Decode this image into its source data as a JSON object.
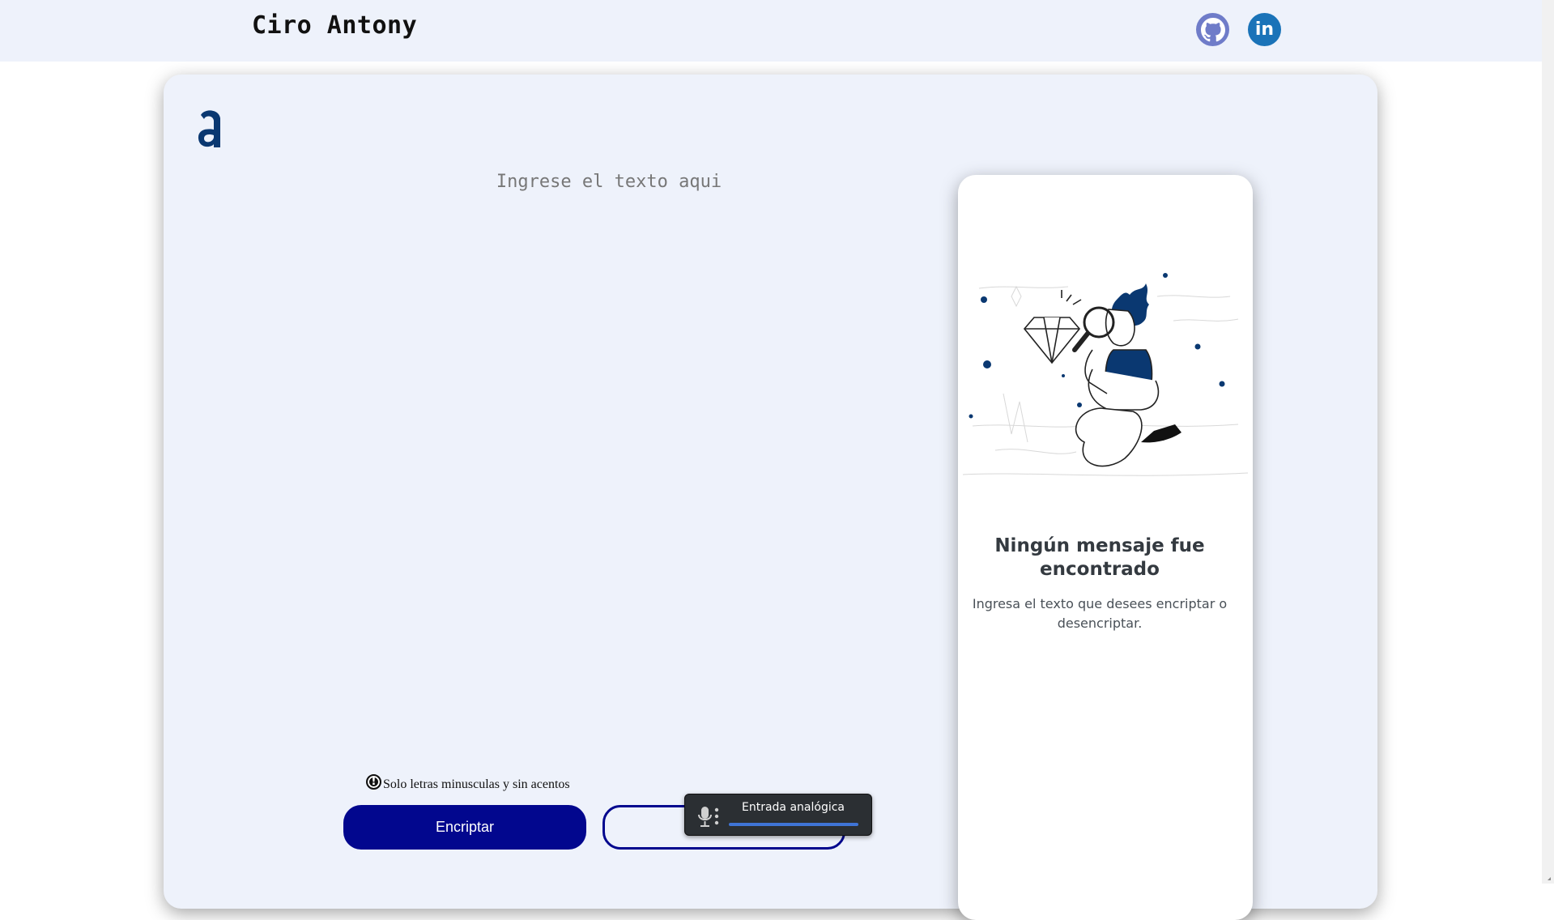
{
  "header": {
    "brand": "Ciro Antony",
    "links": [
      {
        "name": "github",
        "icon": "github-icon",
        "color": "#6f7cc9"
      },
      {
        "name": "linkedin",
        "icon": "linkedin-icon",
        "label": "in",
        "color": "#1a73b8"
      }
    ]
  },
  "editor": {
    "logo_icon": "alura-logo-icon",
    "placeholder": "Ingrese el texto aqui",
    "hint_icon": "exclamation-icon",
    "hint_icon_glyph": "!",
    "hint_text": "Solo letras minusculas y sin acentos",
    "encrypt_label": "Encriptar",
    "decrypt_label": "",
    "accent": "#02078e"
  },
  "tooltip": {
    "icon": "microphone-icon",
    "text": "Entrada analógica",
    "bar_color": "#3f74d6"
  },
  "output": {
    "illustration": "person-with-magnifier-illustration",
    "title": "Ningún mensaje fue encontrado",
    "text": "Ingresa el texto que desees encriptar o desencriptar."
  }
}
